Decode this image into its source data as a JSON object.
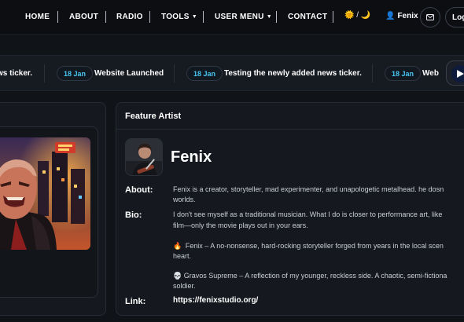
{
  "nav": {
    "items": [
      "HOME",
      "ABOUT",
      "RADIO",
      "TOOLS",
      "USER MENU",
      "CONTACT"
    ],
    "theme_toggle": "🌞 / 🌙",
    "user_name": "Fenix",
    "login_label": "Log"
  },
  "ticker": {
    "leading_text": "ws ticker.",
    "items": [
      {
        "date": "18 Jan",
        "text": "Website Launched"
      },
      {
        "date": "18 Jan",
        "text": "Testing the newly added news ticker."
      },
      {
        "date": "18 Jan",
        "text": "Web"
      }
    ]
  },
  "feature": {
    "heading": "Feature Artist",
    "artist_name": "Fenix",
    "about_label": "About:",
    "about_lines": [
      "Fenix is a  creator, storyteller, mad experimenter, and unapologetic metalhead. he dosn",
      "worlds."
    ],
    "bio_label": "Bio:",
    "bio_lines": [
      "I don't see myself as a traditional musician. What I do is closer to performance art, like",
      "film—only the movie plays out in your ears."
    ],
    "persona1_emoji": "🔥",
    "persona1_lines": [
      "Fenix – A no-nonsense, hard-rocking storyteller forged from years in the local scen",
      "heart."
    ],
    "persona2_emoji": "💀",
    "persona2_lines": [
      "Gravos Supreme – A reflection of my younger, reckless side. A chaotic, semi-fictiona",
      "soldier."
    ],
    "link_label": "Link:",
    "link_url": "https://fenixstudio.org/"
  },
  "colors": {
    "background": "#101318",
    "card": "#15181e",
    "date_accent": "#48c4f0",
    "user_icon": "#8a6cff"
  }
}
